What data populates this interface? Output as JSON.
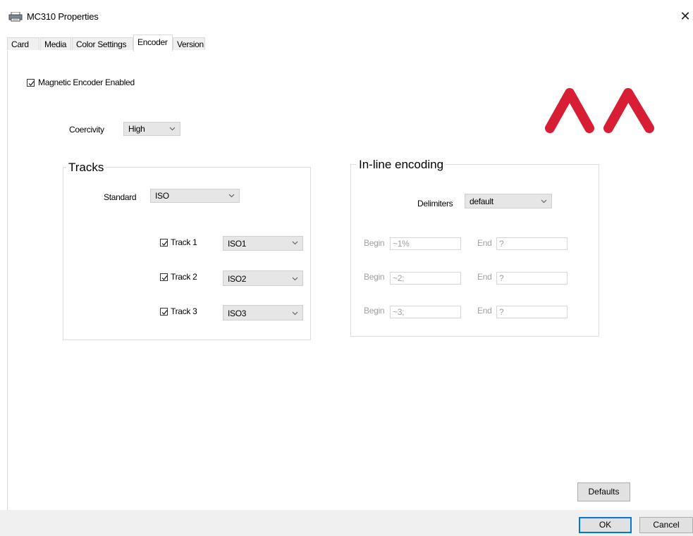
{
  "window": {
    "title": "MC310 Properties",
    "close_glyph": "✕"
  },
  "tabs": [
    {
      "label": "Card"
    },
    {
      "label": "Media"
    },
    {
      "label": "Color Settings"
    },
    {
      "label": "Encoder",
      "active": true
    },
    {
      "label": "Version"
    }
  ],
  "encoder": {
    "magnetic_enabled_label": "Magnetic Encoder Enabled",
    "magnetic_enabled": true,
    "coercivity_label": "Coercivity",
    "coercivity_value": "High"
  },
  "tracks": {
    "title": "Tracks",
    "standard_label": "Standard",
    "standard_value": "ISO",
    "items": [
      {
        "label": "Track 1",
        "checked": true,
        "value": "ISO1"
      },
      {
        "label": "Track 2",
        "checked": true,
        "value": "ISO2"
      },
      {
        "label": "Track 3",
        "checked": true,
        "value": "ISO3"
      }
    ]
  },
  "inline": {
    "title": "In-line encoding",
    "delimiters_label": "Delimiters",
    "delimiters_value": "default",
    "rows": [
      {
        "begin_label": "Begin",
        "begin_value": "~1%",
        "end_label": "End",
        "end_value": "?"
      },
      {
        "begin_label": "Begin",
        "begin_value": "~2;",
        "end_label": "End",
        "end_value": "?"
      },
      {
        "begin_label": "Begin",
        "begin_value": "~3;",
        "end_label": "End",
        "end_value": "?"
      }
    ]
  },
  "buttons": {
    "defaults": "Defaults",
    "ok": "OK",
    "cancel": "Cancel"
  },
  "colors": {
    "logo_red": "#d71e35",
    "focus_blue": "#0078d7"
  },
  "icons": {
    "app": "printer-icon",
    "logo": "brand-logo-icon"
  }
}
